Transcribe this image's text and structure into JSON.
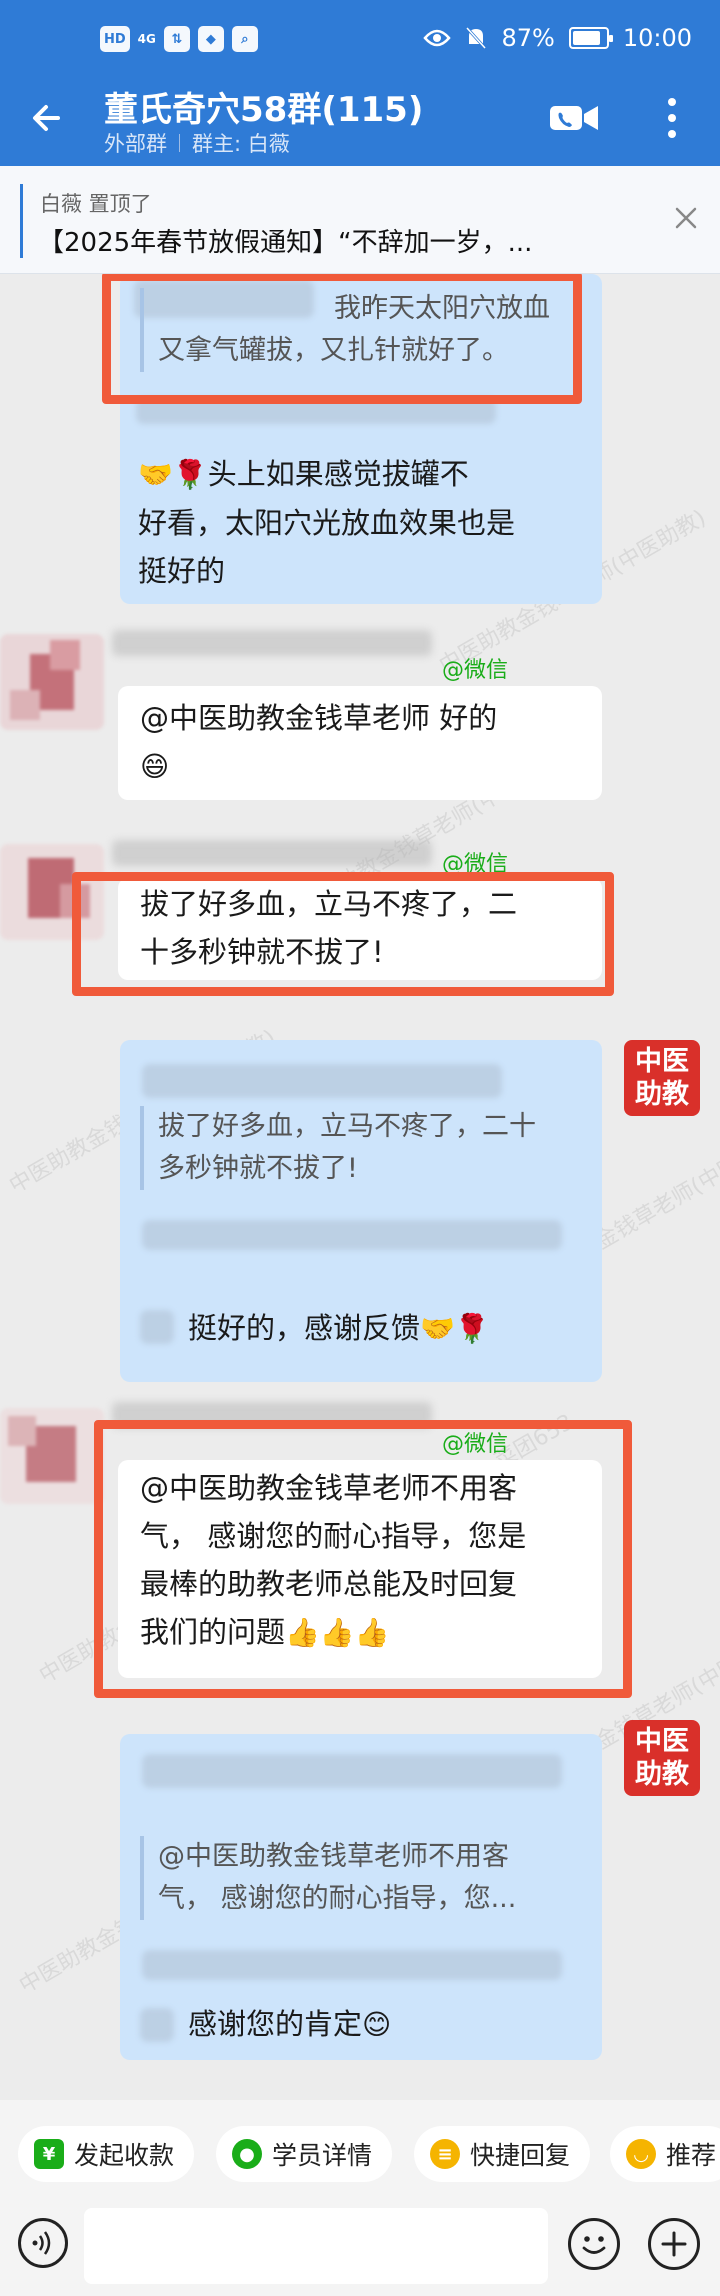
{
  "status_bar": {
    "chips": [
      "HD",
      "⇅",
      "◆",
      "◎",
      "⌕"
    ],
    "signal": "4G",
    "battery_text": "87%",
    "time": "10:00"
  },
  "header": {
    "title": "董氏奇穴58群(115)",
    "tag": "外部群",
    "owner": "群主: 白薇"
  },
  "pinned": {
    "who": "白薇 置顶了",
    "text": "【2025年春节放假通知】“不辞加一岁，..."
  },
  "messages": {
    "m1_line1": "我昨天太阳穴放血",
    "m1_line2": "又拿气罐拔，又扎针就好了。",
    "m1_reply_l1": "头上如果感觉拔罐不",
    "m1_reply_l2": "好看，太阳穴光放血效果也是",
    "m1_reply_l3": "挺好的",
    "m2_source": "@微信",
    "m2_l1": "@中医助教金钱草老师 好的",
    "m3_source": "@微信",
    "m3_l1": "拔了好多血，立马不疼了，二",
    "m3_l2": "十多秒钟就不拔了!",
    "m4_quote_l1": "拔了好多血，立马不疼了，二十",
    "m4_quote_l2": "多秒钟就不拔了!",
    "m4_reply": "挺好的，感谢反馈",
    "m5_source": "@微信",
    "m5_l1": "@中医助教金钱草老师不用客",
    "m5_l2": "气， 感谢您的耐心指导，您是",
    "m5_l3": "最棒的助教老师总能及时回复",
    "m5_l4": "我们的问题",
    "m6_quote_l1": "@中医助教金钱草老师不用客",
    "m6_quote_l2": "气， 感谢您的耐心指导，您...",
    "m6_reply": "感谢您的肯定"
  },
  "badge": {
    "line1": "中医",
    "line2": "助教"
  },
  "watermark_texts": [
    "中医助教金钱草老师(中医助教)",
    "菜团653"
  ],
  "quick_replies": [
    {
      "label": "发起收款",
      "icon": "¥",
      "color": "#1aad19"
    },
    {
      "label": "学员详情",
      "icon": "●",
      "color": "#1aad19"
    },
    {
      "label": "快捷回复",
      "icon": "≡",
      "color": "#f5b400"
    },
    {
      "label": "推荐",
      "icon": "◡",
      "color": "#f5b400"
    }
  ],
  "colors": {
    "brand": "#2f7bd6",
    "highlight": "#f05a3a",
    "badge": "#d9302a"
  }
}
